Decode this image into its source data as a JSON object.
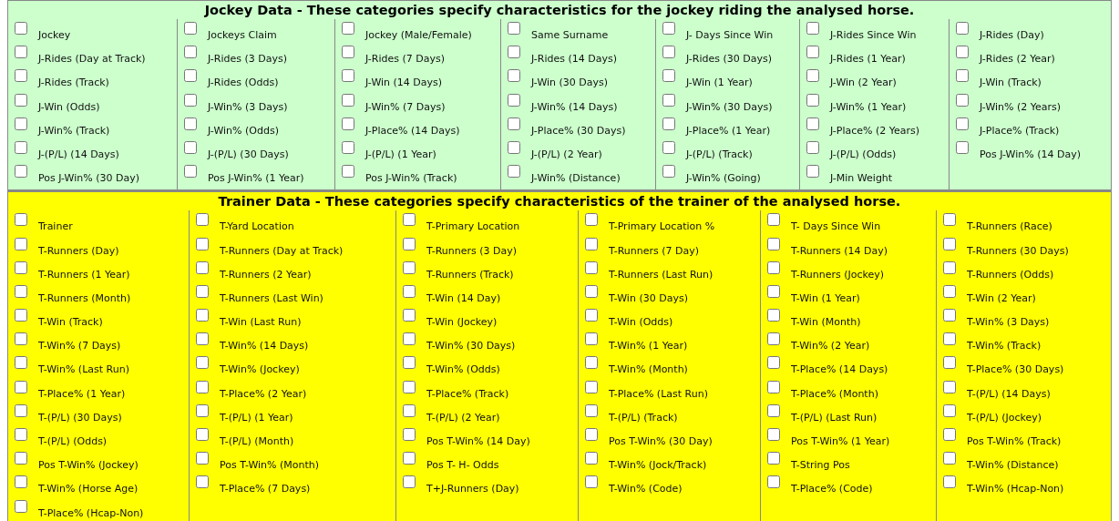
{
  "sections": [
    {
      "kind": "jockey",
      "title": "Jockey Data - These categories specify characteristics for the jockey riding the analysed horse.",
      "columns": [
        [
          {
            "label": "Jockey",
            "checked": false
          },
          {
            "label": "J-Rides (Day at Track)",
            "checked": false
          },
          {
            "label": "J-Rides (Track)",
            "checked": false
          },
          {
            "label": "J-Win (Odds)",
            "checked": false
          },
          {
            "label": "J-Win% (Track)",
            "checked": false
          },
          {
            "label": "J-(P/L) (14 Days)",
            "checked": false
          },
          {
            "label": "Pos J-Win% (30 Day)",
            "checked": false
          }
        ],
        [
          {
            "label": "Jockeys Claim",
            "checked": false
          },
          {
            "label": "J-Rides (3 Days)",
            "checked": false
          },
          {
            "label": "J-Rides (Odds)",
            "checked": false
          },
          {
            "label": "J-Win% (3 Days)",
            "checked": false
          },
          {
            "label": "J-Win% (Odds)",
            "checked": false
          },
          {
            "label": "J-(P/L) (30 Days)",
            "checked": false
          },
          {
            "label": "Pos J-Win% (1 Year)",
            "checked": false
          }
        ],
        [
          {
            "label": "Jockey (Male/Female)",
            "checked": false
          },
          {
            "label": "J-Rides (7 Days)",
            "checked": false
          },
          {
            "label": "J-Win (14 Days)",
            "checked": false
          },
          {
            "label": "J-Win% (7 Days)",
            "checked": false
          },
          {
            "label": "J-Place% (14 Days)",
            "checked": false
          },
          {
            "label": "J-(P/L) (1 Year)",
            "checked": false
          },
          {
            "label": "Pos J-Win% (Track)",
            "checked": false
          }
        ],
        [
          {
            "label": "Same Surname",
            "checked": false
          },
          {
            "label": "J-Rides (14 Days)",
            "checked": false
          },
          {
            "label": "J-Win (30 Days)",
            "checked": false
          },
          {
            "label": "J-Win% (14 Days)",
            "checked": false
          },
          {
            "label": "J-Place% (30 Days)",
            "checked": false
          },
          {
            "label": "J-(P/L) (2 Year)",
            "checked": false
          },
          {
            "label": "J-Win% (Distance)",
            "checked": false
          }
        ],
        [
          {
            "label": "J- Days Since Win",
            "checked": false
          },
          {
            "label": "J-Rides (30 Days)",
            "checked": false
          },
          {
            "label": "J-Win (1 Year)",
            "checked": false
          },
          {
            "label": "J-Win% (30 Days)",
            "checked": false
          },
          {
            "label": "J-Place% (1 Year)",
            "checked": false
          },
          {
            "label": "J-(P/L) (Track)",
            "checked": false
          },
          {
            "label": "J-Win% (Going)",
            "checked": false
          }
        ],
        [
          {
            "label": "J-Rides Since Win",
            "checked": false
          },
          {
            "label": "J-Rides (1 Year)",
            "checked": false
          },
          {
            "label": "J-Win (2 Year)",
            "checked": false
          },
          {
            "label": "J-Win% (1 Year)",
            "checked": false
          },
          {
            "label": "J-Place% (2 Years)",
            "checked": false
          },
          {
            "label": "J-(P/L) (Odds)",
            "checked": false
          },
          {
            "label": "J-Min Weight",
            "checked": false
          }
        ],
        [
          {
            "label": "J-Rides (Day)",
            "checked": false
          },
          {
            "label": "J-Rides (2 Year)",
            "checked": false
          },
          {
            "label": "J-Win (Track)",
            "checked": false
          },
          {
            "label": "J-Win% (2 Years)",
            "checked": false
          },
          {
            "label": "J-Place% (Track)",
            "checked": false
          },
          {
            "label": "Pos J-Win% (14 Day)",
            "checked": false
          }
        ]
      ]
    },
    {
      "kind": "trainer",
      "title": "Trainer Data - These categories specify characteristics of the trainer of the analysed horse.",
      "columns": [
        [
          {
            "label": "Trainer",
            "checked": false
          },
          {
            "label": "T-Runners (Day)",
            "checked": false
          },
          {
            "label": "T-Runners (1 Year)",
            "checked": false
          },
          {
            "label": "T-Runners (Month)",
            "checked": false
          },
          {
            "label": "T-Win (Track)",
            "checked": false
          },
          {
            "label": "T-Win% (7 Days)",
            "checked": false
          },
          {
            "label": "T-Win% (Last Run)",
            "checked": false
          },
          {
            "label": "T-Place% (1 Year)",
            "checked": false
          },
          {
            "label": "T-(P/L) (30 Days)",
            "checked": false
          },
          {
            "label": "T-(P/L) (Odds)",
            "checked": false
          },
          {
            "label": "Pos T-Win% (Jockey)",
            "checked": false
          },
          {
            "label": "T-Win% (Horse Age)",
            "checked": false
          },
          {
            "label": "T-Place% (Hcap-Non)",
            "checked": false
          }
        ],
        [
          {
            "label": "T-Yard Location",
            "checked": false
          },
          {
            "label": "T-Runners (Day at Track)",
            "checked": false
          },
          {
            "label": "T-Runners (2 Year)",
            "checked": false
          },
          {
            "label": "T-Runners (Last Win)",
            "checked": false
          },
          {
            "label": "T-Win (Last Run)",
            "checked": false
          },
          {
            "label": "T-Win% (14 Days)",
            "checked": false
          },
          {
            "label": "T-Win% (Jockey)",
            "checked": false
          },
          {
            "label": "T-Place% (2 Year)",
            "checked": false
          },
          {
            "label": "T-(P/L) (1 Year)",
            "checked": false
          },
          {
            "label": "T-(P/L) (Month)",
            "checked": false
          },
          {
            "label": "Pos T-Win% (Month)",
            "checked": false
          },
          {
            "label": "T-Place% (7 Days)",
            "checked": false
          }
        ],
        [
          {
            "label": "T-Primary Location",
            "checked": false
          },
          {
            "label": "T-Runners (3 Day)",
            "checked": false
          },
          {
            "label": "T-Runners (Track)",
            "checked": false
          },
          {
            "label": "T-Win (14 Day)",
            "checked": false
          },
          {
            "label": "T-Win (Jockey)",
            "checked": false
          },
          {
            "label": "T-Win% (30 Days)",
            "checked": false
          },
          {
            "label": "T-Win% (Odds)",
            "checked": false
          },
          {
            "label": "T-Place% (Track)",
            "checked": false
          },
          {
            "label": "T-(P/L) (2 Year)",
            "checked": false
          },
          {
            "label": "Pos T-Win% (14 Day)",
            "checked": false
          },
          {
            "label": "Pos T- H- Odds",
            "checked": false
          },
          {
            "label": "T+J-Runners (Day)",
            "checked": false
          }
        ],
        [
          {
            "label": "T-Primary Location %",
            "checked": false
          },
          {
            "label": "T-Runners (7 Day)",
            "checked": false
          },
          {
            "label": "T-Runners (Last Run)",
            "checked": false
          },
          {
            "label": "T-Win (30 Days)",
            "checked": false
          },
          {
            "label": "T-Win (Odds)",
            "checked": false
          },
          {
            "label": "T-Win% (1 Year)",
            "checked": false
          },
          {
            "label": "T-Win% (Month)",
            "checked": false
          },
          {
            "label": "T-Place% (Last Run)",
            "checked": false
          },
          {
            "label": "T-(P/L) (Track)",
            "checked": false
          },
          {
            "label": "Pos T-Win% (30 Day)",
            "checked": false
          },
          {
            "label": "T-Win% (Jock/Track)",
            "checked": false
          },
          {
            "label": "T-Win% (Code)",
            "checked": false
          }
        ],
        [
          {
            "label": "T- Days Since Win",
            "checked": false
          },
          {
            "label": "T-Runners (14 Day)",
            "checked": false
          },
          {
            "label": "T-Runners (Jockey)",
            "checked": false
          },
          {
            "label": "T-Win (1 Year)",
            "checked": false
          },
          {
            "label": "T-Win (Month)",
            "checked": false
          },
          {
            "label": "T-Win% (2 Year)",
            "checked": false
          },
          {
            "label": "T-Place% (14 Days)",
            "checked": false
          },
          {
            "label": "T-Place% (Month)",
            "checked": false
          },
          {
            "label": "T-(P/L) (Last Run)",
            "checked": false
          },
          {
            "label": "Pos T-Win% (1 Year)",
            "checked": false
          },
          {
            "label": "T-String Pos",
            "checked": false
          },
          {
            "label": "T-Place% (Code)",
            "checked": false
          }
        ],
        [
          {
            "label": "T-Runners (Race)",
            "checked": false
          },
          {
            "label": "T-Runners (30 Days)",
            "checked": false
          },
          {
            "label": "T-Runners (Odds)",
            "checked": false
          },
          {
            "label": "T-Win (2 Year)",
            "checked": false
          },
          {
            "label": "T-Win% (3 Days)",
            "checked": false
          },
          {
            "label": "T-Win% (Track)",
            "checked": false
          },
          {
            "label": "T-Place% (30 Days)",
            "checked": false
          },
          {
            "label": "T-(P/L) (14 Days)",
            "checked": false
          },
          {
            "label": "T-(P/L) (Jockey)",
            "checked": false
          },
          {
            "label": "Pos T-Win% (Track)",
            "checked": false
          },
          {
            "label": "T-Win% (Distance)",
            "checked": false
          },
          {
            "label": "T-Win% (Hcap-Non)",
            "checked": false
          }
        ]
      ]
    }
  ]
}
